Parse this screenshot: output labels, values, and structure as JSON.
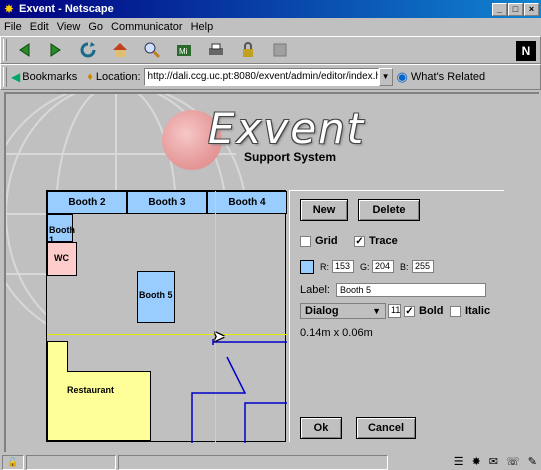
{
  "window": {
    "title": "Exvent - Netscape",
    "controls": {
      "minimize": "_",
      "maximize": "□",
      "close": "×"
    }
  },
  "menu": [
    "File",
    "Edit",
    "View",
    "Go",
    "Communicator",
    "Help"
  ],
  "nav_icons": [
    "back-icon",
    "forward-icon",
    "reload-icon",
    "home-icon",
    "search-icon",
    "my-netscape-icon",
    "print-icon",
    "security-icon",
    "stop-icon"
  ],
  "location": {
    "bookmarks_label": "Bookmarks",
    "location_label": "Location:",
    "url": "http://dali.ccg.uc.pt:8080/exvent/admin/editor/index.html",
    "related_label": "What's Related"
  },
  "logo": {
    "title": "Exvent",
    "subtitle": "Support System"
  },
  "editor": {
    "booth_tabs": [
      "Booth 2",
      "Booth 3",
      "Booth 4"
    ],
    "rooms": {
      "booth1": "Booth 1",
      "wc": "WC",
      "booth5": "Booth 5",
      "restaurant": "Restaurant"
    },
    "colors": {
      "booth": "#99ccff",
      "wc": "#ffcccc",
      "restaurant": "#ffff99",
      "guide": "#e8e800",
      "path": "#0000cc"
    }
  },
  "panel": {
    "new_button": "New",
    "delete_button": "Delete",
    "grid_label": "Grid",
    "grid_checked": false,
    "trace_label": "Trace",
    "trace_checked": true,
    "color": {
      "swatch": "#99ccff",
      "r_label": "R:",
      "r": "153",
      "g_label": "G:",
      "g": "204",
      "b_label": "B:",
      "b": "255"
    },
    "label_caption": "Label:",
    "label_value": "Booth 5",
    "font": "Dialog",
    "font_size": "11",
    "bold_label": "Bold",
    "bold_checked": true,
    "italic_label": "Italic",
    "italic_checked": false,
    "size_text": "0.14m x 0.06m",
    "ok_button": "Ok",
    "cancel_button": "Cancel"
  }
}
